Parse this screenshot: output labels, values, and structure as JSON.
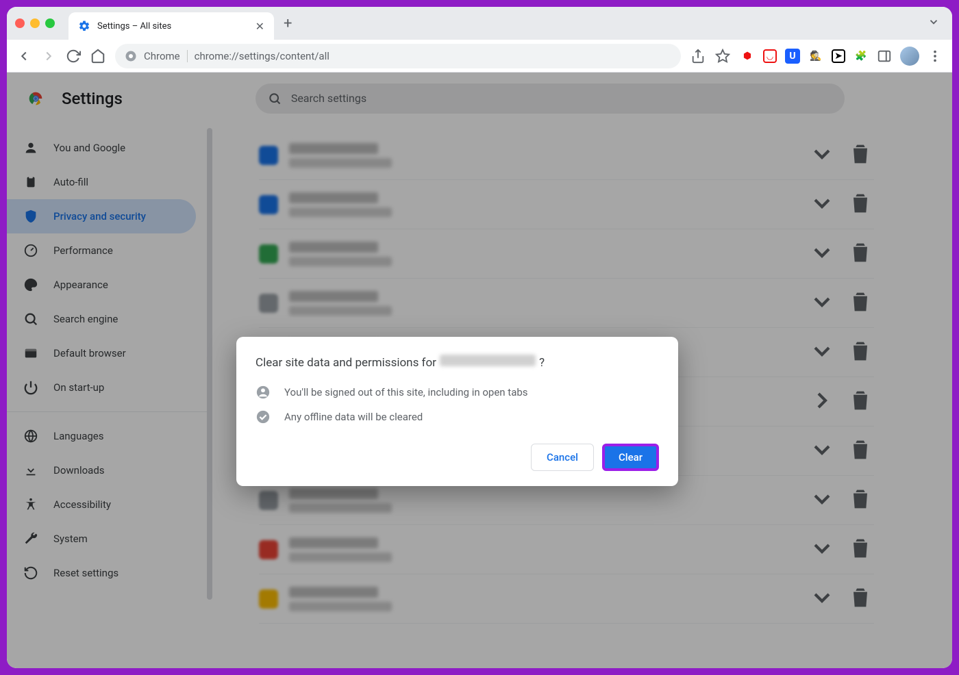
{
  "tab": {
    "title": "Settings – All sites"
  },
  "address": {
    "label": "Chrome",
    "url": "chrome://settings/content/all"
  },
  "header": {
    "title": "Settings",
    "search_placeholder": "Search settings"
  },
  "sidebar": {
    "items": [
      {
        "label": "You and Google",
        "icon": "person"
      },
      {
        "label": "Auto-fill",
        "icon": "clipboard"
      },
      {
        "label": "Privacy and security",
        "icon": "shield",
        "active": true
      },
      {
        "label": "Performance",
        "icon": "gauge"
      },
      {
        "label": "Appearance",
        "icon": "palette"
      },
      {
        "label": "Search engine",
        "icon": "search"
      },
      {
        "label": "Default browser",
        "icon": "window"
      },
      {
        "label": "On start-up",
        "icon": "power"
      }
    ],
    "items2": [
      {
        "label": "Languages",
        "icon": "globe"
      },
      {
        "label": "Downloads",
        "icon": "download"
      },
      {
        "label": "Accessibility",
        "icon": "accessibility"
      },
      {
        "label": "System",
        "icon": "wrench"
      },
      {
        "label": "Reset settings",
        "icon": "reset"
      }
    ]
  },
  "sites": {
    "count": 10,
    "colors": [
      "#1a73e8",
      "#1a73e8",
      "#34a853",
      "#9aa0a6",
      "#9aa0a6",
      "#9aa0a6",
      "#9aa0a6",
      "#9aa0a6",
      "#ea4335",
      "#fbbc04"
    ]
  },
  "dialog": {
    "title_prefix": "Clear site data and permissions for",
    "title_suffix": "?",
    "line1": "You'll be signed out of this site, including in open tabs",
    "line2": "Any offline data will be cleared",
    "cancel": "Cancel",
    "clear": "Clear"
  },
  "colors": {
    "accent": "#1a73e8",
    "highlight_border": "#9b1fe8"
  }
}
